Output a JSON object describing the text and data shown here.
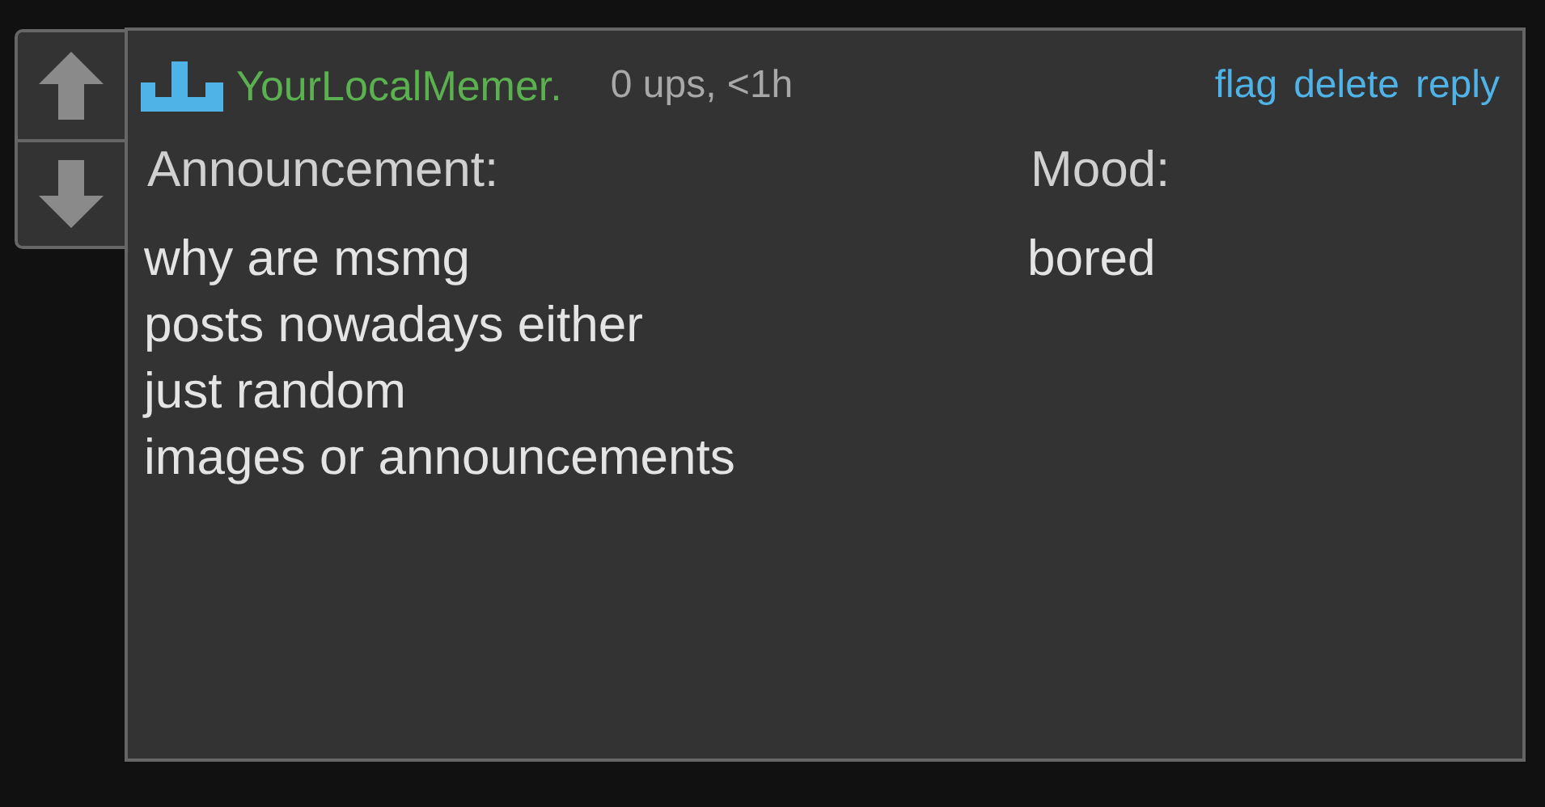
{
  "comment": {
    "username": "YourLocalMemer.",
    "meta": "0 ups, <1h",
    "actions": [
      "flag",
      "delete",
      "reply"
    ],
    "columns": [
      {
        "heading": "Announcement:",
        "lines": [
          "why are msmg",
          "posts nowadays either",
          "just random",
          "images or announcements"
        ]
      },
      {
        "heading": "Mood:",
        "lines": [
          "bored"
        ]
      }
    ]
  }
}
